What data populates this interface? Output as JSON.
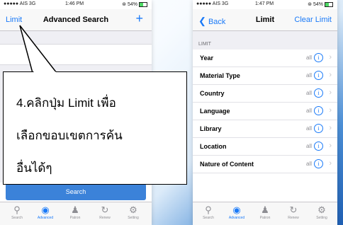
{
  "left": {
    "status": {
      "carrier": "●●●●● AIS  3G",
      "time": "1:46 PM",
      "battery": "⊛ 54%"
    },
    "nav": {
      "left": "Limit",
      "title": "Advanced Search",
      "right": "+"
    },
    "search_button": "Search",
    "callout": {
      "line1": "4.คลิกปุ่ม Limit เพื่อ",
      "line2": "เลือกขอบเขตการค้น",
      "line3": "อื่นได้ๆ"
    },
    "tabs": [
      {
        "label": "Search",
        "icon": "magnifier-icon"
      },
      {
        "label": "Advanced",
        "icon": "advanced-search-icon"
      },
      {
        "label": "Patron",
        "icon": "patron-icon"
      },
      {
        "label": "Renew",
        "icon": "renew-icon"
      },
      {
        "label": "Setting",
        "icon": "gear-icon"
      }
    ],
    "active_tab": "Advanced"
  },
  "right": {
    "status": {
      "carrier": "●●●●● AIS  3G",
      "time": "1:47 PM",
      "battery": "⊛ 54%"
    },
    "nav": {
      "back": "Back",
      "title": "Limit",
      "right": "Clear Limit"
    },
    "section": "LIMIT",
    "rows": [
      {
        "label": "Year",
        "value": "all"
      },
      {
        "label": "Material Type",
        "value": "all"
      },
      {
        "label": "Country",
        "value": "all"
      },
      {
        "label": "Language",
        "value": "all"
      },
      {
        "label": "Library",
        "value": "all"
      },
      {
        "label": "Location",
        "value": "all"
      },
      {
        "label": "Nature of Content",
        "value": "all"
      }
    ],
    "tabs": [
      {
        "label": "Search"
      },
      {
        "label": "Advanced"
      },
      {
        "label": "Patron"
      },
      {
        "label": "Renew"
      },
      {
        "label": "Setting"
      }
    ],
    "active_tab": "Advanced"
  },
  "colors": {
    "accent": "#1a7af8",
    "search_button": "#3b82d9",
    "background_gradient_end": "#1f5fb3"
  }
}
